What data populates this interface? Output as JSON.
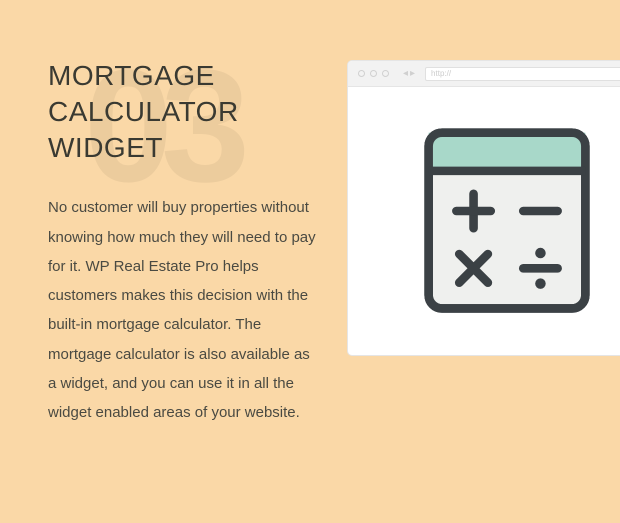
{
  "section_number": "03",
  "heading": "MORTGAGE CALCULATOR WIDGET",
  "body": "No customer will buy properties without knowing how much they will need to pay for it. WP Real Estate Pro helps customers makes this decision with the built-in mortgage calculator. The mortgage calculator is also available as a widget, and you can use it in all the widget enabled areas of your website.",
  "browser": {
    "url_placeholder": "http://"
  },
  "icon": {
    "name": "calculator-icon",
    "colors": {
      "outline": "#3b4145",
      "screen": "#a8d8c9",
      "body": "#eff0ee"
    }
  }
}
